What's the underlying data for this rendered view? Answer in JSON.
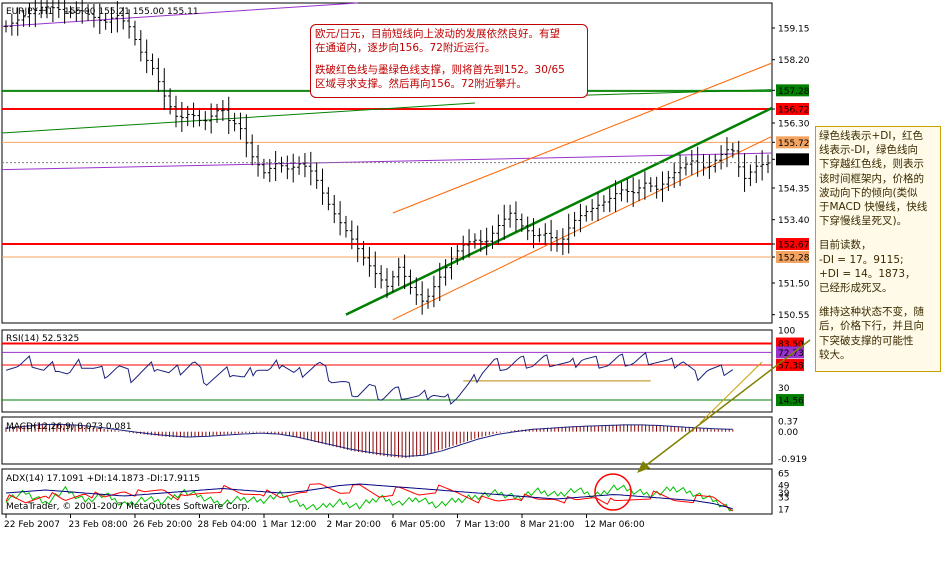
{
  "header": {
    "symbol": "EURJPY,H1",
    "ohlc": "155.00 155.21 155.00 155.11",
    "copyright": "MetaTrader, © 2001-2007 MetaQuotes Software Corp."
  },
  "annotation_top": {
    "lines": [
      "欧元/日元，目前短线向上波动的发展依然良好。有望",
      "在通道内，逐步向156。72附近运行。",
      "",
      "跌破红色线与墨绿色线支撑，则将首先到152。30/65",
      "区域寻求支撑。然后再向156。72附近攀升。"
    ]
  },
  "annotation_side": {
    "para1": [
      "绿色线表示+DI，红色",
      "线表示-DI，绿色线向",
      "下穿越红色线，则表示",
      "该时间框架内，价格的",
      "波动向下的倾向(类似",
      "于MACD 快慢线，快线",
      "下穿慢线呈死叉)。"
    ],
    "para2": [
      "目前读数，",
      "-DI = 17。9115;",
      "+DI = 14。1873，",
      "已经形成死叉。"
    ],
    "para3": [
      "维持这种状态不变，随",
      "后，价格下行，并且向",
      "下突破支撑的可能性",
      "较大。"
    ]
  },
  "colors": {
    "price_bars": "#000000",
    "red_level": "#ff0000",
    "orange_level": "#f4a460",
    "green_level": "#008000",
    "purple_line": "#9932cc",
    "channel_orange": "#ff6600",
    "trend_green": "#008000",
    "rsi_line": "#1a237e",
    "macd_hist": "#8b0000",
    "adx_plus": "#00c000",
    "adx_minus": "#ff0000",
    "adx_main": "#000080",
    "note_red": "#c00000",
    "note_border": "#c8a000",
    "arrow": "#808000"
  },
  "chart_data": [
    {
      "type": "line",
      "title": "EURJPY,H1",
      "ylim": [
        150.3,
        159.9
      ],
      "price_ticks": [
        "159.15",
        "158.20",
        "157.28",
        "156.72",
        "156.30",
        "155.72",
        "155.21",
        "154.35",
        "153.40",
        "152.67",
        "152.28",
        "151.50",
        "150.55"
      ],
      "tagged_levels": [
        {
          "label": "157.28",
          "value": 157.28,
          "color": "#008000"
        },
        {
          "label": "156.72",
          "value": 156.72,
          "color": "#ff0000"
        },
        {
          "label": "155.72",
          "value": 155.72,
          "color": "#f4a460"
        },
        {
          "label": "155.21",
          "value": 155.21,
          "color": "#000000"
        },
        {
          "label": "152.67",
          "value": 152.67,
          "color": "#ff0000"
        },
        {
          "label": "152.28",
          "value": 152.28,
          "color": "#f4a460"
        }
      ],
      "x_labels": [
        "22 Feb 2007",
        "23 Feb 08:00",
        "26 Feb 20:00",
        "28 Feb 04:00",
        "1 Mar 12:00",
        "2 Mar 20:00",
        "6 Mar 05:00",
        "7 Mar 13:00",
        "8 Mar 21:00",
        "12 Mar 06:00"
      ],
      "close_path": [
        [
          0,
          159.2
        ],
        [
          3,
          159.5
        ],
        [
          6,
          159.8
        ],
        [
          8,
          159.75
        ],
        [
          10,
          159.6
        ],
        [
          12,
          159.7
        ],
        [
          14,
          159.5
        ],
        [
          16,
          159.3
        ],
        [
          18,
          159.55
        ],
        [
          20,
          159.2
        ],
        [
          22,
          158.4
        ],
        [
          24,
          157.9
        ],
        [
          26,
          157.0
        ],
        [
          28,
          156.4
        ],
        [
          30,
          156.6
        ],
        [
          32,
          156.3
        ],
        [
          34,
          156.6
        ],
        [
          35,
          156.8
        ],
        [
          36,
          156.4
        ],
        [
          38,
          156.2
        ],
        [
          40,
          155.3
        ],
        [
          42,
          154.8
        ],
        [
          44,
          155.1
        ],
        [
          46,
          154.9
        ],
        [
          48,
          155.1
        ],
        [
          50,
          154.8
        ],
        [
          52,
          154.0
        ],
        [
          54,
          153.4
        ],
        [
          56,
          152.9
        ],
        [
          58,
          152.3
        ],
        [
          60,
          151.8
        ],
        [
          62,
          151.4
        ],
        [
          64,
          152.0
        ],
        [
          66,
          151.3
        ],
        [
          68,
          150.9
        ],
        [
          70,
          151.5
        ],
        [
          72,
          152.1
        ],
        [
          74,
          152.6
        ],
        [
          76,
          152.8
        ],
        [
          78,
          152.7
        ],
        [
          80,
          153.2
        ],
        [
          82,
          153.6
        ],
        [
          84,
          153.2
        ],
        [
          86,
          152.9
        ],
        [
          88,
          153.0
        ],
        [
          90,
          152.6
        ],
        [
          92,
          153.3
        ],
        [
          94,
          153.6
        ],
        [
          96,
          153.8
        ],
        [
          98,
          154.0
        ],
        [
          100,
          154.3
        ],
        [
          102,
          154.2
        ],
        [
          104,
          154.5
        ],
        [
          106,
          154.3
        ],
        [
          108,
          154.7
        ],
        [
          110,
          155.0
        ],
        [
          112,
          155.2
        ],
        [
          114,
          154.9
        ],
        [
          116,
          155.3
        ],
        [
          118,
          155.6
        ],
        [
          120,
          154.6
        ],
        [
          122,
          155.0
        ],
        [
          124,
          155.1
        ]
      ]
    },
    {
      "type": "line",
      "title": "RSI(14) 52.5325",
      "ylim": [
        0,
        100
      ],
      "ticks": [
        "100",
        "83.50",
        "72.73",
        "57.38",
        "30",
        "14.56"
      ],
      "levels": [
        {
          "label": "83.50",
          "value": 83.5,
          "color": "#ff0000"
        },
        {
          "label": "72.73",
          "value": 72.73,
          "color": "#9932cc"
        },
        {
          "label": "57.38",
          "value": 57.38,
          "color": "#ff0000"
        },
        {
          "label": "14.56",
          "value": 14.56,
          "color": "#008000"
        }
      ],
      "values": [
        58,
        55,
        62,
        50,
        57,
        45,
        60,
        52,
        48,
        55,
        42,
        50,
        58,
        46,
        52,
        60,
        38,
        44,
        50,
        40,
        56,
        48,
        62,
        45,
        52,
        58,
        40,
        34,
        22,
        30,
        18,
        26,
        20,
        16,
        24,
        14,
        20,
        32,
        50,
        60,
        55,
        62,
        58,
        64,
        60,
        56,
        66,
        62,
        58,
        64,
        60,
        66,
        62,
        58,
        63,
        44,
        52,
        50,
        52.53
      ]
    },
    {
      "type": "bar",
      "title": "MACD(12,26,9) 0.073 0.081",
      "ylim": [
        -1.1,
        0.5
      ],
      "ticks": [
        "0.37",
        "0.00",
        "-0.919"
      ],
      "values": [
        0.15,
        0.22,
        0.28,
        0.25,
        0.2,
        0.12,
        0.05,
        -0.05,
        -0.12,
        -0.18,
        -0.2,
        -0.15,
        -0.1,
        -0.05,
        -0.02,
        -0.08,
        -0.2,
        -0.35,
        -0.5,
        -0.65,
        -0.75,
        -0.85,
        -0.9,
        -0.8,
        -0.6,
        -0.4,
        -0.2,
        -0.05,
        0.05,
        0.1,
        0.14,
        0.18,
        0.2,
        0.22,
        0.25,
        0.24,
        0.2,
        0.16,
        0.12,
        0.08,
        0.073
      ],
      "signal": [
        0.12,
        0.18,
        0.24,
        0.25,
        0.22,
        0.16,
        0.08,
        0.0,
        -0.08,
        -0.14,
        -0.18,
        -0.16,
        -0.12,
        -0.08,
        -0.05,
        -0.08,
        -0.18,
        -0.32,
        -0.46,
        -0.6,
        -0.7,
        -0.78,
        -0.84,
        -0.8,
        -0.65,
        -0.45,
        -0.25,
        -0.1,
        0.0,
        0.08,
        0.12,
        0.16,
        0.19,
        0.21,
        0.23,
        0.23,
        0.21,
        0.17,
        0.13,
        0.1,
        0.081
      ]
    },
    {
      "type": "line",
      "title": "ADX(14) 17.1091 +DI:14.1873 -DI:17.9115",
      "ylim": [
        10,
        70
      ],
      "ticks": [
        "65",
        "49",
        "39",
        "33",
        "17"
      ],
      "series": [
        {
          "name": "+DI",
          "values": [
            30,
            38,
            25,
            42,
            28,
            36,
            22,
            30,
            26,
            40,
            32,
            24,
            30,
            28,
            36,
            22,
            18,
            26,
            20,
            32,
            24,
            30,
            22,
            28,
            34,
            38,
            32,
            40,
            36,
            42,
            34,
            46,
            40,
            36,
            44,
            38,
            28,
            14.19
          ]
        },
        {
          "name": "-DI",
          "values": [
            32,
            24,
            38,
            26,
            40,
            30,
            42,
            36,
            44,
            30,
            38,
            44,
            36,
            40,
            30,
            42,
            48,
            40,
            46,
            34,
            42,
            36,
            44,
            38,
            30,
            26,
            34,
            28,
            32,
            26,
            34,
            24,
            30,
            36,
            28,
            30,
            32,
            17.91
          ]
        },
        {
          "name": "ADX",
          "values": [
            38,
            40,
            42,
            40,
            38,
            36,
            34,
            36,
            38,
            40,
            42,
            44,
            42,
            40,
            38,
            40,
            44,
            48,
            50,
            48,
            46,
            44,
            42,
            40,
            38,
            36,
            34,
            32,
            30,
            32,
            34,
            36,
            34,
            32,
            30,
            28,
            24,
            17.11
          ]
        }
      ]
    }
  ]
}
